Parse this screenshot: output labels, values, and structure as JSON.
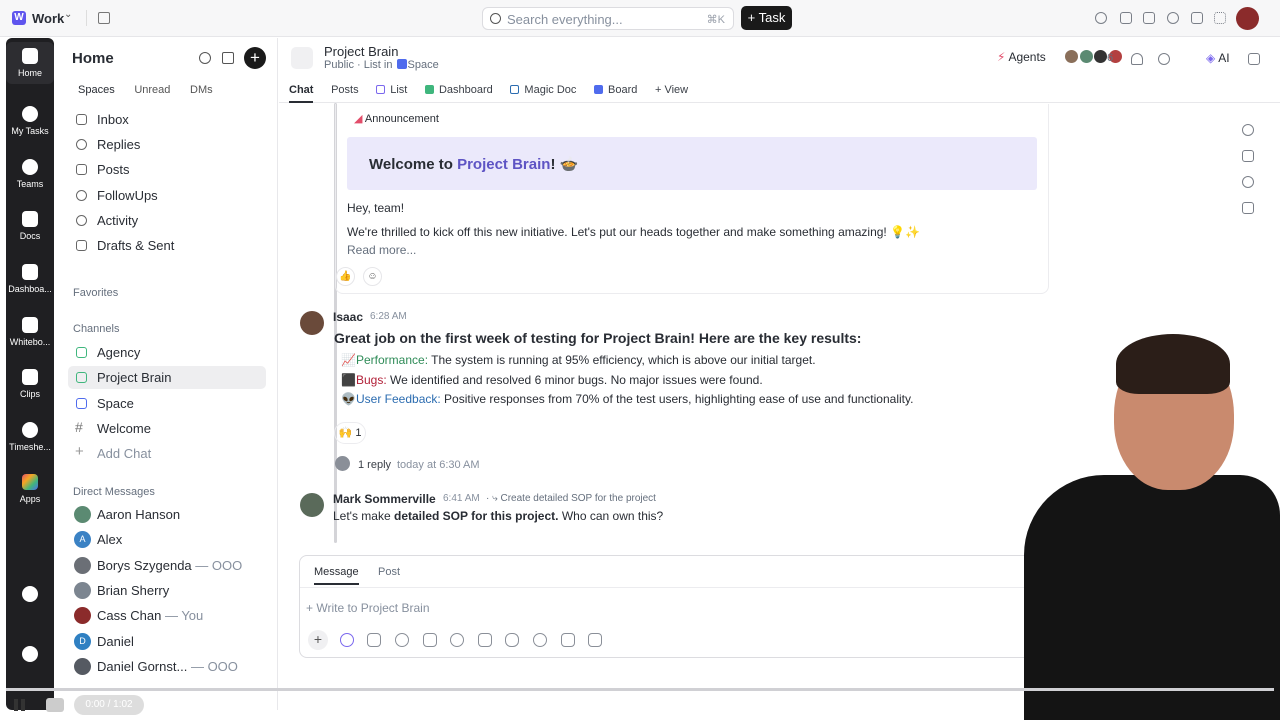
{
  "topbar": {
    "workspace_initial": "W",
    "workspace_name": "Work",
    "search_placeholder": "Search everything...",
    "search_shortcut": "⌘K",
    "task_button": "+ Task"
  },
  "rail": [
    {
      "label": "Home"
    },
    {
      "label": "My Tasks"
    },
    {
      "label": "Teams"
    },
    {
      "label": "Docs"
    },
    {
      "label": "Dashboa..."
    },
    {
      "label": "Whitebo..."
    },
    {
      "label": "Clips"
    },
    {
      "label": "Timeshe..."
    },
    {
      "label": "Apps"
    }
  ],
  "sidebar": {
    "title": "Home",
    "tabs": [
      "Spaces",
      "Unread",
      "DMs"
    ],
    "nav": [
      "Inbox",
      "Replies",
      "Posts",
      "FollowUps",
      "Activity",
      "Drafts & Sent"
    ],
    "favorites_label": "Favorites",
    "channels_label": "Channels",
    "channels": [
      "Agency",
      "Project Brain",
      "Space",
      "Welcome",
      "Add Chat"
    ],
    "dm_label": "Direct Messages",
    "dms": [
      {
        "name": "Aaron Hanson",
        "status": "",
        "initial": "",
        "color": "#5b8a72"
      },
      {
        "name": "Alex",
        "status": "",
        "initial": "A",
        "color": "#3b82c4"
      },
      {
        "name": "Borys Szygenda",
        "status": "— OOO",
        "initial": "",
        "color": "#6b6f76"
      },
      {
        "name": "Brian Sherry",
        "status": "",
        "initial": "",
        "color": "#7c8590"
      },
      {
        "name": "Cass Chan",
        "status": "— You",
        "initial": "",
        "color": "#8b2b2b"
      },
      {
        "name": "Daniel",
        "status": "",
        "initial": "D",
        "color": "#2f80c2"
      },
      {
        "name": "Daniel Gornst...",
        "status": "— OOO",
        "initial": "",
        "color": "#555a62"
      }
    ]
  },
  "header": {
    "title": "Project Brain",
    "subtitle_prefix": "Public · List in",
    "subtitle_space": "Space",
    "tabs": [
      "Chat",
      "Posts",
      "List",
      "Dashboard",
      "Magic Doc",
      "Board",
      "+ View"
    ],
    "agents_label": "Agents",
    "people_count": "6",
    "ai_label": "AI"
  },
  "announcement": {
    "label": "Announcement",
    "welcome_prefix": "Welcome to",
    "welcome_highlight": "Project Brain",
    "welcome_suffix": "! 🍲",
    "greeting": "Hey, team!",
    "body": "We're thrilled to kick off this new initiative. Let's put our heads together and make something amazing! 💡✨",
    "read_more": "Read more..."
  },
  "message1": {
    "author": "Isaac",
    "time": "6:28 AM",
    "lead": "Great job on the first week of testing for Project Brain! Here are the key results:",
    "bullets": [
      {
        "icon": "📈",
        "key": "Performance:",
        "text": "The system is running at 95% efficiency, which is above our initial target."
      },
      {
        "icon": "⬛",
        "key": "Bugs:",
        "text": "We identified and resolved 6 minor bugs. No major issues were found."
      },
      {
        "icon": "👽",
        "key": "User Feedback:",
        "text": "Positive responses from 70% of the test users, highlighting ease of use and functionality."
      }
    ],
    "reaction": "🙌 1",
    "reply_count": "1 reply",
    "reply_time": "today at 6:30 AM"
  },
  "message2": {
    "author": "Mark Sommerville",
    "time": "6:41 AM",
    "task_ref": "Create detailed SOP for the project",
    "text_before": "Let's make",
    "text_bold": "detailed SOP for this project.",
    "text_after": "Who can own this?"
  },
  "composer": {
    "tab_message": "Message",
    "tab_post": "Post",
    "placeholder": "+ Write to Project Brain"
  },
  "player": {
    "time": "0:00 / 1:02"
  }
}
